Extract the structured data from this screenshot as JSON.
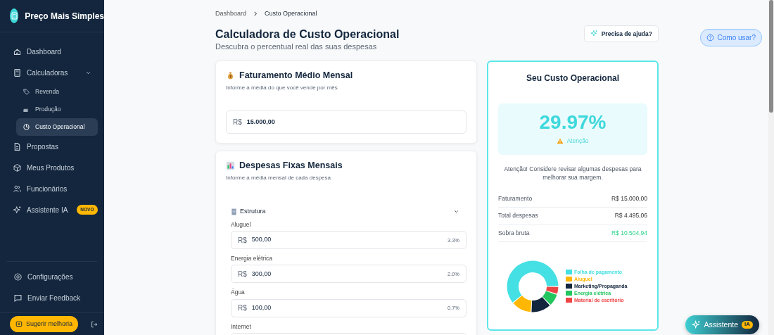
{
  "sidebar": {
    "brand": "Preço Mais Simples",
    "items": [
      {
        "label": "Dashboard",
        "selected": false
      },
      {
        "label": "Calculadoras",
        "selected": false,
        "expanded": true,
        "children": [
          {
            "label": "Revenda",
            "selected": false
          },
          {
            "label": "Produção",
            "selected": false
          },
          {
            "label": "Custo Operacional",
            "selected": true
          }
        ]
      },
      {
        "label": "Propostas",
        "selected": false
      },
      {
        "label": "Meus Produtos",
        "selected": false
      },
      {
        "label": "Funcionários",
        "selected": false
      },
      {
        "label": "Assistente IA",
        "selected": false,
        "badge": "NOVO"
      }
    ],
    "footer_items": [
      {
        "label": "Configurações"
      },
      {
        "label": "Enviar Feedback"
      }
    ],
    "suggest_button": "Sugerir melhoria"
  },
  "breadcrumb": [
    "Dashboard",
    "Custo Operacional"
  ],
  "header": {
    "title": "Calculadora de Custo Operacional",
    "subtitle": "Descubra o percentual real das suas despesas",
    "help_button": "Precisa de ajuda?",
    "how_button": "Como usar?"
  },
  "revenue_card": {
    "title": "Faturamento Médio Mensal",
    "subtitle": "Informe a média do que você vende por mês",
    "prefix": "R$",
    "value": "15.000,00"
  },
  "expenses_card": {
    "title": "Despesas Fixas Mensais",
    "subtitle": "Informe a média mensal de cada despesa",
    "groups": [
      {
        "label": "Estrutura",
        "expanded": true,
        "fields": [
          {
            "label": "Aluguel",
            "prefix": "R$",
            "value": "500,00",
            "percent": "3.3%"
          },
          {
            "label": "Energia elétrica",
            "prefix": "R$",
            "value": "300,00",
            "percent": "2.0%"
          },
          {
            "label": "Água",
            "prefix": "R$",
            "value": "100,00",
            "percent": "0.7%"
          },
          {
            "label": "Internet"
          }
        ]
      }
    ]
  },
  "result_card": {
    "title": "Seu Custo Operacional",
    "percent": "29.97%",
    "status": "Atenção",
    "message": "Atenção! Considere revisar algumas despesas para melhorar sua margem.",
    "rows": [
      {
        "label": "Faturamento",
        "value": "R$ 15.000,00",
        "kind": "plain"
      },
      {
        "label": "Total despesas",
        "value": "R$ 4.495,06",
        "kind": "plain"
      },
      {
        "label": "Sobra bruta",
        "value": "R$ 10.504,94",
        "kind": "positive"
      }
    ],
    "legend": [
      {
        "label": "Folha de pagamento",
        "color": "#45e0e3"
      },
      {
        "label": "Aluguel",
        "color": "#ffb703"
      },
      {
        "label": "Marketing/Propaganda",
        "color": "#13263d"
      },
      {
        "label": "Energia elétrica",
        "color": "#22c55e"
      },
      {
        "label": "Material de escritório",
        "color": "#ef4444"
      }
    ]
  },
  "assistant_button": {
    "label": "Assistente",
    "badge": "IA"
  }
}
